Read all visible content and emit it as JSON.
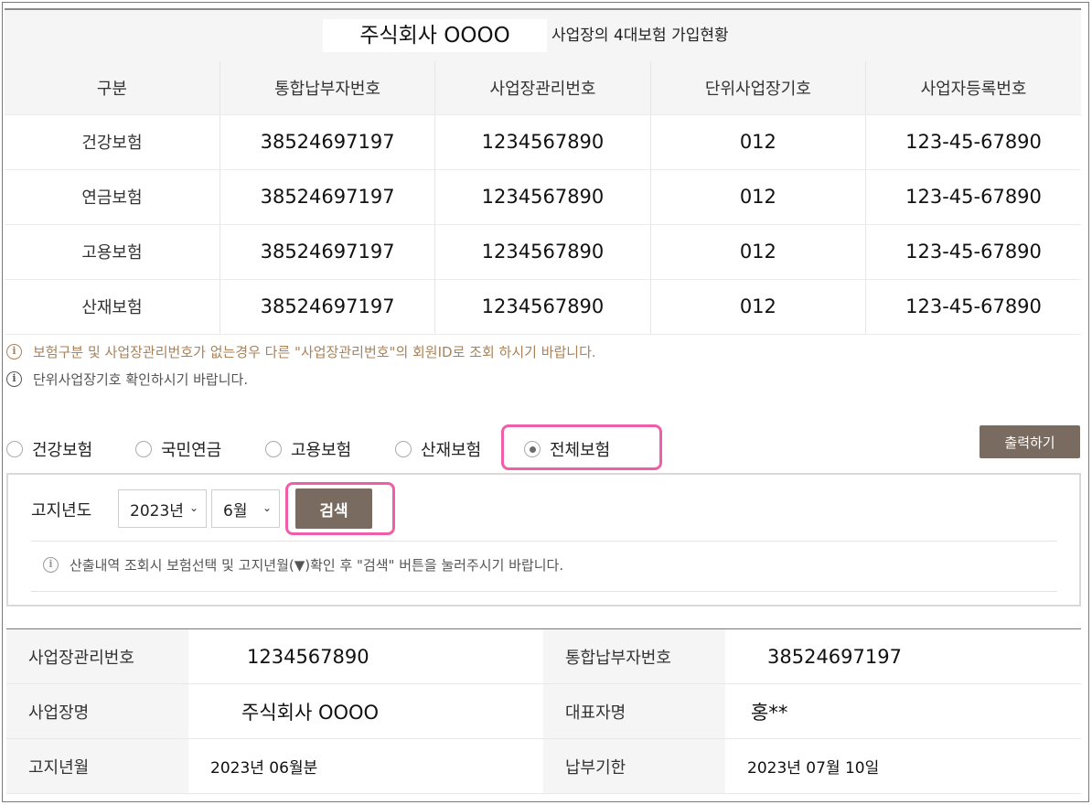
{
  "title": {
    "company": "주식회사 OOOO",
    "suffix": "사업장의 4대보험 가입현황"
  },
  "insurance_table": {
    "headers": [
      "구분",
      "통합납부자번호",
      "사업장관리번호",
      "단위사업장기호",
      "사업자등록번호"
    ],
    "rows": [
      [
        "건강보험",
        "38524697197",
        "1234567890",
        "012",
        "123-45-67890"
      ],
      [
        "연금보험",
        "38524697197",
        "1234567890",
        "012",
        "123-45-67890"
      ],
      [
        "고용보험",
        "38524697197",
        "1234567890",
        "012",
        "123-45-67890"
      ],
      [
        "산재보험",
        "38524697197",
        "1234567890",
        "012",
        "123-45-67890"
      ]
    ]
  },
  "notices": {
    "line1": "보험구분 및 사업장관리번호가 없는경우 다른 \"사업장관리번호\"의 회원ID로 조회 하시기 바랍니다.",
    "line2": "단위사업장기호 확인하시기 바랍니다."
  },
  "insurance_filter": {
    "options": [
      "건강보험",
      "국민연금",
      "고용보험",
      "산재보험",
      "전체보험"
    ],
    "selected": "전체보험"
  },
  "print_button": "출력하기",
  "search": {
    "label": "고지년도",
    "year": "2023년",
    "month": "6월",
    "button": "검색",
    "notice": "산출내역 조회시 보험선택 및 고지년월(▼)확인 후 \"검색\" 버튼을 눌러주시기 바랍니다."
  },
  "details": {
    "mgmt_no_label": "사업장관리번호",
    "mgmt_no": "1234567890",
    "payer_no_label": "통합납부자번호",
    "payer_no": "38524697197",
    "company_label": "사업장명",
    "company": "주식회사 OOOO",
    "ceo_label": "대표자명",
    "ceo": "홍**",
    "notice_month_label": "고지년월",
    "notice_month": "2023년 06월분",
    "due_label": "납부기한",
    "due": "2023년 07월 10일"
  },
  "colors": {
    "button": "#7a6b61",
    "highlight": "#ef5fa9",
    "notice_accent": "#a9825a"
  },
  "icons": [
    "info-icon",
    "chevron-down-icon"
  ]
}
